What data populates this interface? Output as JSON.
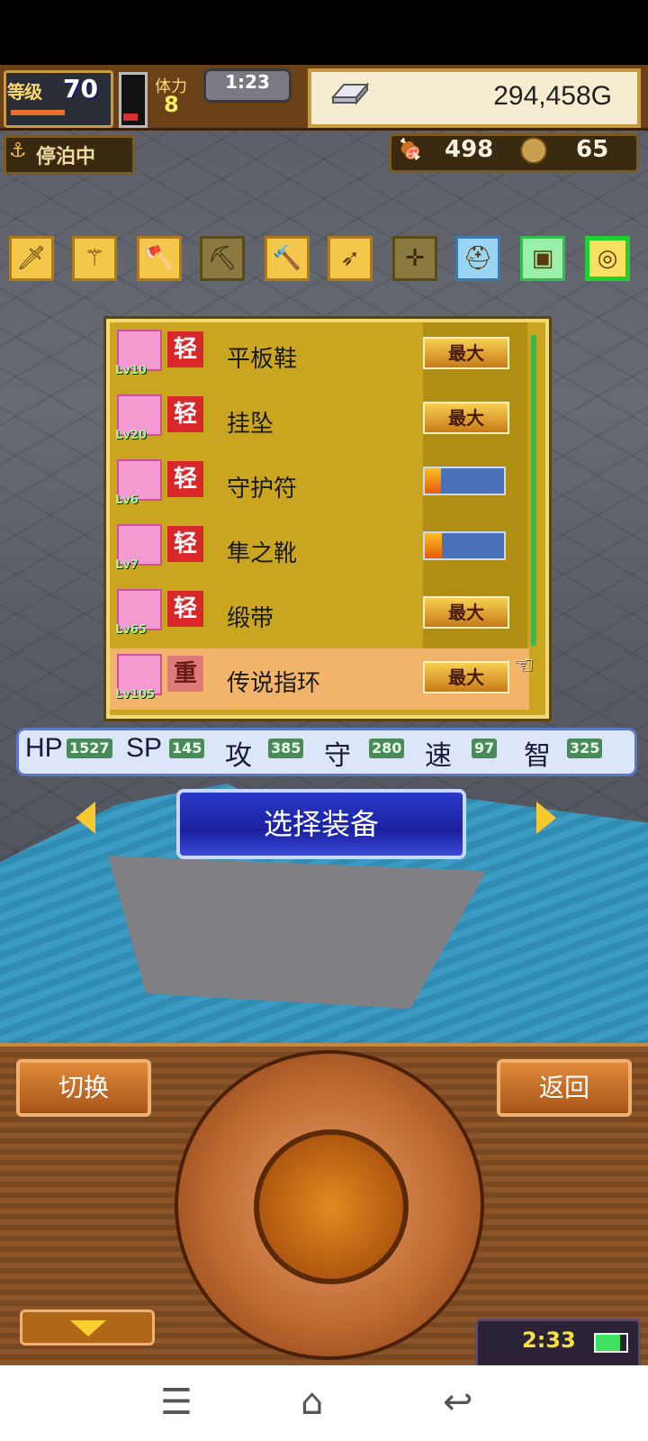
{
  "hud": {
    "level_label": "等级",
    "level_value": "70",
    "stamina_label": "体力",
    "stamina_value": "8",
    "clock": "1:23",
    "gold": "294,458G",
    "anchored_status": "停泊中",
    "food_value": "498",
    "coin_value": "65"
  },
  "categories": [
    {
      "name": "sword",
      "icon": "sword-icon",
      "glyph": "🗡"
    },
    {
      "name": "spear",
      "icon": "spear-icon",
      "glyph": "⚚"
    },
    {
      "name": "axe",
      "icon": "axe-icon",
      "glyph": "🪓"
    },
    {
      "name": "pickaxe",
      "icon": "pickaxe-icon",
      "glyph": "⛏"
    },
    {
      "name": "hammer",
      "icon": "hammer-icon",
      "glyph": "🔨"
    },
    {
      "name": "bow",
      "icon": "bow-icon",
      "glyph": "➶"
    },
    {
      "name": "crossbow",
      "icon": "crossbow-icon",
      "glyph": "✛"
    },
    {
      "name": "helmet",
      "icon": "helmet-icon",
      "glyph": "⛑"
    },
    {
      "name": "armor",
      "icon": "armor-icon",
      "glyph": "▣"
    },
    {
      "name": "accessory",
      "icon": "necklace-icon",
      "glyph": "◎"
    }
  ],
  "equipment": [
    {
      "name": "平板鞋",
      "lv": "Lv10",
      "weight": "轻",
      "status": "最大"
    },
    {
      "name": "挂坠",
      "lv": "Lv20",
      "weight": "轻",
      "status": "最大"
    },
    {
      "name": "守护符",
      "lv": "Lv6",
      "weight": "轻",
      "status": "",
      "progress": 0.2
    },
    {
      "name": "隼之靴",
      "lv": "Lv7",
      "weight": "轻",
      "status": "",
      "progress": 0.22
    },
    {
      "name": "缎带",
      "lv": "Lv65",
      "weight": "轻",
      "status": "最大"
    },
    {
      "name": "传说指环",
      "lv": "Lv105",
      "weight": "重",
      "status": "最大",
      "selected": true
    }
  ],
  "stats": {
    "hp_label": "HP",
    "hp": "1527",
    "sp_label": "SP",
    "sp": "145",
    "atk_label": "攻",
    "atk": "385",
    "def_label": "守",
    "def": "280",
    "spd_label": "速",
    "spd": "97",
    "int_label": "智",
    "int": "325"
  },
  "select_button": "选择装备",
  "controls": {
    "switch_label": "切换",
    "back_label": "返回",
    "clock": "2:33"
  },
  "colors": {
    "list_bg": "#c9a520",
    "select_button": "#1a20a0",
    "active_category_border": "#20d030",
    "max_badge": "#f8d050"
  }
}
